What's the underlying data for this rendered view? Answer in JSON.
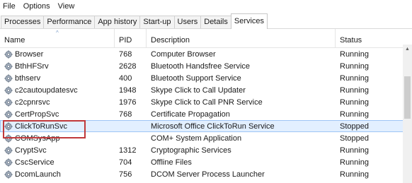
{
  "menu": [
    "File",
    "Options",
    "View"
  ],
  "tabs": [
    "Processes",
    "Performance",
    "App history",
    "Start-up",
    "Users",
    "Details",
    "Services"
  ],
  "active_tab": "Services",
  "columns": {
    "name": "Name",
    "pid": "PID",
    "description": "Description",
    "status": "Status"
  },
  "rows": [
    {
      "name": "Browser",
      "pid": "768",
      "description": "Computer Browser",
      "status": "Running"
    },
    {
      "name": "BthHFSrv",
      "pid": "2628",
      "description": "Bluetooth Handsfree Service",
      "status": "Running"
    },
    {
      "name": "bthserv",
      "pid": "400",
      "description": "Bluetooth Support Service",
      "status": "Running"
    },
    {
      "name": "c2cautoupdatesvc",
      "pid": "1948",
      "description": "Skype Click to Call Updater",
      "status": "Running"
    },
    {
      "name": "c2cpnrsvc",
      "pid": "1976",
      "description": "Skype Click to Call PNR Service",
      "status": "Running"
    },
    {
      "name": "CertPropSvc",
      "pid": "768",
      "description": "Certificate Propagation",
      "status": "Running"
    },
    {
      "name": "ClickToRunSvc",
      "pid": "",
      "description": "Microsoft Office ClickToRun Service",
      "status": "Stopped"
    },
    {
      "name": "COMSysApp",
      "pid": "",
      "description": "COM+ System Application",
      "status": "Stopped"
    },
    {
      "name": "CryptSvc",
      "pid": "1312",
      "description": "Cryptographic Services",
      "status": "Running"
    },
    {
      "name": "CscService",
      "pid": "704",
      "description": "Offline Files",
      "status": "Running"
    },
    {
      "name": "DcomLaunch",
      "pid": "756",
      "description": "DCOM Server Process Launcher",
      "status": "Running"
    }
  ],
  "selected_row": "ClickToRunSvc",
  "colors": {
    "selection_bg": "#e2efff",
    "selection_border": "#9ec5f5",
    "highlight": "#c0393b"
  }
}
